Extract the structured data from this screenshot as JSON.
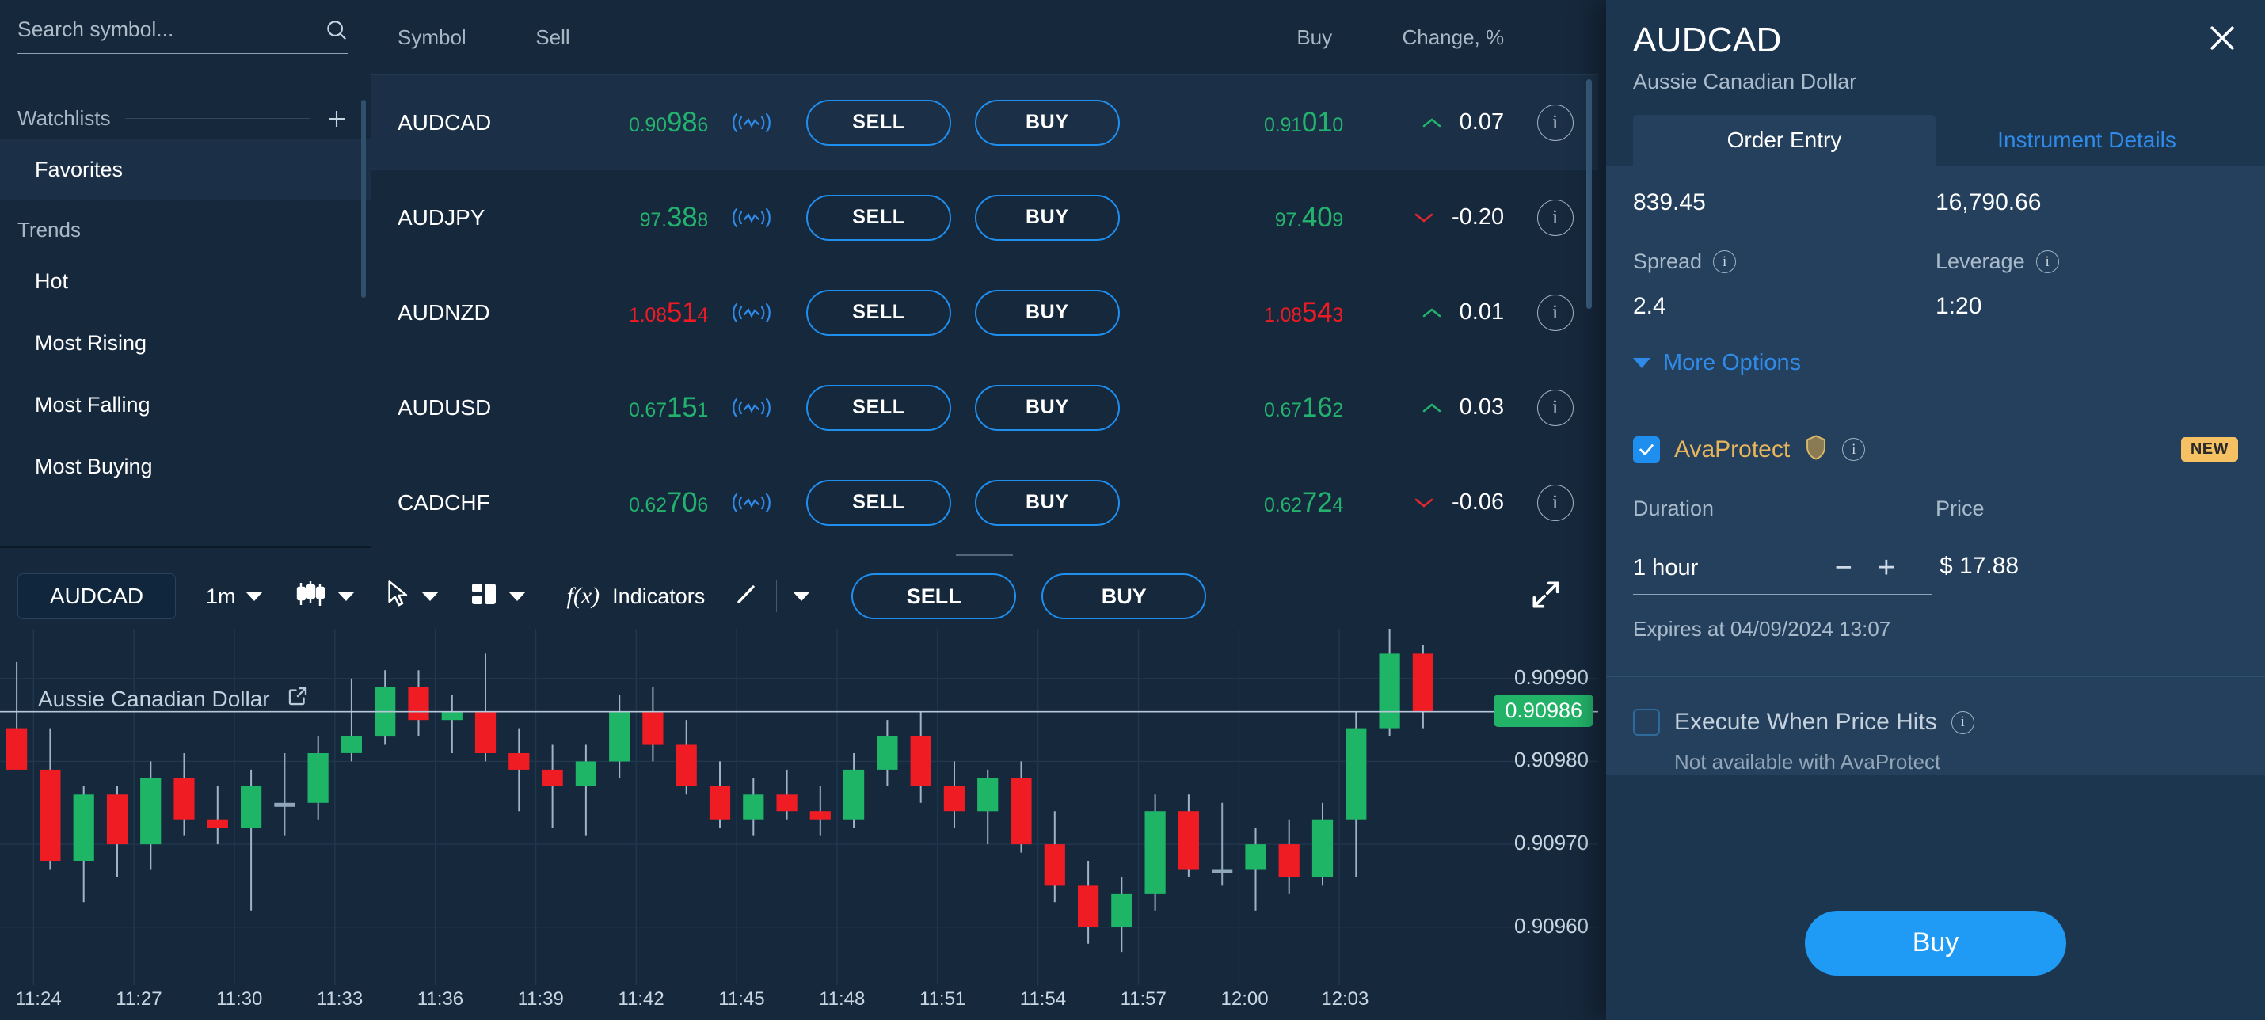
{
  "sidebar": {
    "search": {
      "placeholder": "Search symbol...",
      "value": ""
    },
    "watchlists_label": "Watchlists",
    "favorites_label": "Favorites",
    "trends_label": "Trends",
    "trend_items": [
      {
        "label": "Hot"
      },
      {
        "label": "Most Rising"
      },
      {
        "label": "Most Falling"
      },
      {
        "label": "Most Buying"
      }
    ]
  },
  "quotes": {
    "columns": {
      "symbol": "Symbol",
      "sell": "Sell",
      "buy": "Buy",
      "change": "Change, %"
    },
    "sell_button_label": "SELL",
    "buy_button_label": "BUY",
    "rows": [
      {
        "symbol": "AUDCAD",
        "sell_pre": "0.90",
        "sell_big": "98",
        "sell_post": "6",
        "sell_dir": "up",
        "buy_pre": "0.91",
        "buy_big": "01",
        "buy_post": "0",
        "buy_dir": "up",
        "change": "0.07",
        "change_dir": "up",
        "selected": true
      },
      {
        "symbol": "AUDJPY",
        "sell_pre": "97.",
        "sell_big": "38",
        "sell_post": "8",
        "sell_dir": "up",
        "buy_pre": "97.",
        "buy_big": "40",
        "buy_post": "9",
        "buy_dir": "up",
        "change": "-0.20",
        "change_dir": "down",
        "selected": false
      },
      {
        "symbol": "AUDNZD",
        "sell_pre": "1.08",
        "sell_big": "51",
        "sell_post": "4",
        "sell_dir": "down",
        "buy_pre": "1.08",
        "buy_big": "54",
        "buy_post": "3",
        "buy_dir": "down",
        "change": "0.01",
        "change_dir": "up",
        "selected": false
      },
      {
        "symbol": "AUDUSD",
        "sell_pre": "0.67",
        "sell_big": "15",
        "sell_post": "1",
        "sell_dir": "up",
        "buy_pre": "0.67",
        "buy_big": "16",
        "buy_post": "2",
        "buy_dir": "up",
        "change": "0.03",
        "change_dir": "up",
        "selected": false
      },
      {
        "symbol": "CADCHF",
        "sell_pre": "0.62",
        "sell_big": "70",
        "sell_post": "6",
        "sell_dir": "up",
        "buy_pre": "0.62",
        "buy_big": "72",
        "buy_post": "4",
        "buy_dir": "up",
        "change": "-0.06",
        "change_dir": "down",
        "selected": false
      }
    ]
  },
  "chart_toolbar": {
    "symbol": "AUDCAD",
    "timeframe": "1m",
    "chart_type_icon": "candlestick-icon",
    "cursor_icon": "cursor-icon",
    "layout_icon": "layout-icon",
    "indicators_label": "Indicators",
    "indicators_prefix": "f(x)",
    "drawing_icon": "trendline-icon",
    "sell_label": "SELL",
    "buy_label": "BUY",
    "expand_icon": "expand-icon"
  },
  "chart": {
    "title": "Aussie Canadian Dollar",
    "open_external_icon": "external-link-icon"
  },
  "chart_data": {
    "type": "candlestick",
    "title": "Aussie Canadian Dollar",
    "symbol": "AUDCAD",
    "timeframe": "1m",
    "xlabel": "",
    "ylabel": "",
    "grid": true,
    "ylim": [
      0.90953,
      0.90996
    ],
    "y_ticks": [
      "0.90990",
      "0.90980",
      "0.90970",
      "0.90960"
    ],
    "y_tick_values": [
      0.9099,
      0.9098,
      0.9097,
      0.9096
    ],
    "last_price": "0.90986",
    "last_price_value": 0.90986,
    "last_price_color": "#22b268",
    "x_ticks": [
      "11:24",
      "11:27",
      "11:30",
      "11:33",
      "11:36",
      "11:39",
      "11:42",
      "11:45",
      "11:48",
      "11:51",
      "11:54",
      "11:57",
      "12:00",
      "12:03"
    ],
    "up_color": "#1fb567",
    "down_color": "#f01c24",
    "candles": [
      {
        "t": "11:23",
        "o": 0.90984,
        "h": 0.90992,
        "l": 0.90979,
        "c": 0.90979,
        "d": "down"
      },
      {
        "t": "11:24",
        "o": 0.90979,
        "h": 0.90984,
        "l": 0.90967,
        "c": 0.90968,
        "d": "down"
      },
      {
        "t": "11:25",
        "o": 0.90968,
        "h": 0.90977,
        "l": 0.90963,
        "c": 0.90976,
        "d": "up"
      },
      {
        "t": "11:26",
        "o": 0.90976,
        "h": 0.90977,
        "l": 0.90966,
        "c": 0.9097,
        "d": "down"
      },
      {
        "t": "11:27",
        "o": 0.9097,
        "h": 0.9098,
        "l": 0.90967,
        "c": 0.90978,
        "d": "up"
      },
      {
        "t": "11:28",
        "o": 0.90978,
        "h": 0.90981,
        "l": 0.90971,
        "c": 0.90973,
        "d": "down"
      },
      {
        "t": "11:29",
        "o": 0.90973,
        "h": 0.90977,
        "l": 0.9097,
        "c": 0.90972,
        "d": "down"
      },
      {
        "t": "11:30",
        "o": 0.90972,
        "h": 0.90979,
        "l": 0.90962,
        "c": 0.90977,
        "d": "up"
      },
      {
        "t": "11:31",
        "o": 0.90975,
        "h": 0.90981,
        "l": 0.90971,
        "c": 0.90975,
        "d": "flat"
      },
      {
        "t": "11:32",
        "o": 0.90975,
        "h": 0.90983,
        "l": 0.90973,
        "c": 0.90981,
        "d": "up"
      },
      {
        "t": "11:33",
        "o": 0.90981,
        "h": 0.9099,
        "l": 0.9098,
        "c": 0.90983,
        "d": "up"
      },
      {
        "t": "11:34",
        "o": 0.90983,
        "h": 0.90991,
        "l": 0.90982,
        "c": 0.90989,
        "d": "up"
      },
      {
        "t": "11:35",
        "o": 0.90989,
        "h": 0.90991,
        "l": 0.90983,
        "c": 0.90985,
        "d": "down"
      },
      {
        "t": "11:36",
        "o": 0.90985,
        "h": 0.90988,
        "l": 0.90981,
        "c": 0.90986,
        "d": "up"
      },
      {
        "t": "11:37",
        "o": 0.90986,
        "h": 0.90993,
        "l": 0.9098,
        "c": 0.90981,
        "d": "down"
      },
      {
        "t": "11:38",
        "o": 0.90981,
        "h": 0.90984,
        "l": 0.90974,
        "c": 0.90979,
        "d": "down"
      },
      {
        "t": "11:39",
        "o": 0.90979,
        "h": 0.90982,
        "l": 0.90972,
        "c": 0.90977,
        "d": "down"
      },
      {
        "t": "11:40",
        "o": 0.90977,
        "h": 0.90982,
        "l": 0.90971,
        "c": 0.9098,
        "d": "up"
      },
      {
        "t": "11:41",
        "o": 0.9098,
        "h": 0.90988,
        "l": 0.90978,
        "c": 0.90986,
        "d": "up"
      },
      {
        "t": "11:42",
        "o": 0.90986,
        "h": 0.90989,
        "l": 0.9098,
        "c": 0.90982,
        "d": "down"
      },
      {
        "t": "11:43",
        "o": 0.90982,
        "h": 0.90985,
        "l": 0.90976,
        "c": 0.90977,
        "d": "down"
      },
      {
        "t": "11:44",
        "o": 0.90977,
        "h": 0.9098,
        "l": 0.90972,
        "c": 0.90973,
        "d": "down"
      },
      {
        "t": "11:45",
        "o": 0.90973,
        "h": 0.90978,
        "l": 0.90971,
        "c": 0.90976,
        "d": "up"
      },
      {
        "t": "11:46",
        "o": 0.90976,
        "h": 0.90979,
        "l": 0.90973,
        "c": 0.90974,
        "d": "down"
      },
      {
        "t": "11:47",
        "o": 0.90974,
        "h": 0.90977,
        "l": 0.90971,
        "c": 0.90973,
        "d": "down"
      },
      {
        "t": "11:48",
        "o": 0.90973,
        "h": 0.90981,
        "l": 0.90972,
        "c": 0.90979,
        "d": "up"
      },
      {
        "t": "11:49",
        "o": 0.90979,
        "h": 0.90985,
        "l": 0.90977,
        "c": 0.90983,
        "d": "up"
      },
      {
        "t": "11:50",
        "o": 0.90983,
        "h": 0.90986,
        "l": 0.90975,
        "c": 0.90977,
        "d": "down"
      },
      {
        "t": "11:51",
        "o": 0.90977,
        "h": 0.9098,
        "l": 0.90972,
        "c": 0.90974,
        "d": "down"
      },
      {
        "t": "11:52",
        "o": 0.90974,
        "h": 0.90979,
        "l": 0.9097,
        "c": 0.90978,
        "d": "up"
      },
      {
        "t": "11:53",
        "o": 0.90978,
        "h": 0.9098,
        "l": 0.90969,
        "c": 0.9097,
        "d": "down"
      },
      {
        "t": "11:54",
        "o": 0.9097,
        "h": 0.90974,
        "l": 0.90963,
        "c": 0.90965,
        "d": "down"
      },
      {
        "t": "11:55",
        "o": 0.90965,
        "h": 0.90968,
        "l": 0.90958,
        "c": 0.9096,
        "d": "down"
      },
      {
        "t": "11:56",
        "o": 0.9096,
        "h": 0.90966,
        "l": 0.90957,
        "c": 0.90964,
        "d": "up"
      },
      {
        "t": "11:57",
        "o": 0.90964,
        "h": 0.90976,
        "l": 0.90962,
        "c": 0.90974,
        "d": "up"
      },
      {
        "t": "11:58",
        "o": 0.90974,
        "h": 0.90976,
        "l": 0.90966,
        "c": 0.90967,
        "d": "down"
      },
      {
        "t": "11:59",
        "o": 0.90967,
        "h": 0.90975,
        "l": 0.90965,
        "c": 0.90967,
        "d": "flat"
      },
      {
        "t": "12:00",
        "o": 0.90967,
        "h": 0.90972,
        "l": 0.90962,
        "c": 0.9097,
        "d": "up"
      },
      {
        "t": "12:01",
        "o": 0.9097,
        "h": 0.90973,
        "l": 0.90964,
        "c": 0.90966,
        "d": "down"
      },
      {
        "t": "12:02",
        "o": 0.90966,
        "h": 0.90975,
        "l": 0.90965,
        "c": 0.90973,
        "d": "up"
      },
      {
        "t": "12:03",
        "o": 0.90973,
        "h": 0.90986,
        "l": 0.90966,
        "c": 0.90984,
        "d": "up"
      },
      {
        "t": "12:04",
        "o": 0.90984,
        "h": 0.90996,
        "l": 0.90983,
        "c": 0.90993,
        "d": "up"
      },
      {
        "t": "12:05",
        "o": 0.90993,
        "h": 0.90994,
        "l": 0.90984,
        "c": 0.90986,
        "d": "down"
      }
    ]
  },
  "right_panel": {
    "symbol": "AUDCAD",
    "subtitle": "Aussie Canadian Dollar",
    "close_icon": "close-icon",
    "tabs": [
      {
        "label": "Order Entry",
        "active": true
      },
      {
        "label": "Instrument Details",
        "active": false
      }
    ],
    "amount_value": "839.45",
    "units_value": "16,790.66",
    "spread_label": "Spread",
    "spread_value": "2.4",
    "leverage_label": "Leverage",
    "leverage_value": "1:20",
    "more_options_label": "More Options",
    "avaprotect": {
      "label": "AvaProtect",
      "checked": true,
      "badge": "NEW",
      "shield_icon": "shield-icon",
      "duration_label": "Duration",
      "duration_value": "1 hour",
      "minus_label": "−",
      "plus_label": "+",
      "price_label": "Price",
      "price_value": "$ 17.88",
      "expires_text": "Expires at 04/09/2024 13:07"
    },
    "execute_when_price_hits": {
      "label": "Execute When Price Hits",
      "checked": false,
      "note": "Not available with AvaProtect"
    },
    "submit_label": "Buy"
  },
  "colors": {
    "accent": "#1f8fef",
    "up": "#23b26d",
    "down": "#ee1b24",
    "panel": "#24405c",
    "bg": "#16283c"
  }
}
